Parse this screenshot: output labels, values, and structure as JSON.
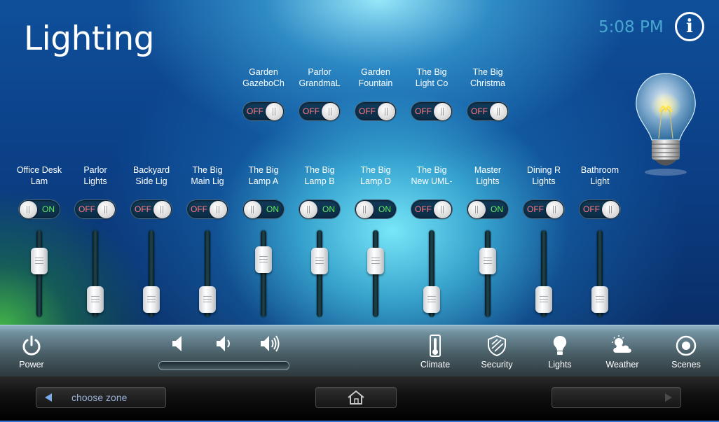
{
  "header": {
    "title": "Lighting",
    "time": "5:08 PM",
    "info_icon": "info-icon",
    "bulb_icon": "light-bulb-icon"
  },
  "top_row": [
    {
      "label": "Garden\nGazeboCh",
      "state": "OFF"
    },
    {
      "label": "Parlor\nGrandmaL",
      "state": "OFF"
    },
    {
      "label": "Garden\nFountain",
      "state": "OFF"
    },
    {
      "label": "The Big\nLight Co",
      "state": "OFF"
    },
    {
      "label": "The Big\nChristma",
      "state": "OFF"
    }
  ],
  "lights": [
    {
      "label": "Office   Desk\nLam",
      "state": "ON",
      "level": 0.72
    },
    {
      "label": "Parlor\nLights",
      "state": "OFF",
      "level": 0.15
    },
    {
      "label": "Backyard\nSide Lig",
      "state": "OFF",
      "level": 0.15
    },
    {
      "label": "The Big\nMain Lig",
      "state": "OFF",
      "level": 0.15
    },
    {
      "label": "The Big\nLamp A",
      "state": "ON",
      "level": 0.74
    },
    {
      "label": "The Big\nLamp B",
      "state": "ON",
      "level": 0.72
    },
    {
      "label": "The Big\nLamp D",
      "state": "ON",
      "level": 0.72
    },
    {
      "label": "The Big\nNew UML-",
      "state": "OFF",
      "level": 0.15
    },
    {
      "label": "Master\nLights",
      "state": "ON",
      "level": 0.72
    },
    {
      "label": "Dining R\nLights",
      "state": "OFF",
      "level": 0.15
    },
    {
      "label": "Bathroom\nLight",
      "state": "OFF",
      "level": 0.15
    }
  ],
  "bottom_bar": {
    "power_label": "Power",
    "nav": [
      {
        "label": "Climate",
        "icon": "thermometer-icon"
      },
      {
        "label": "Security",
        "icon": "shield-icon"
      },
      {
        "label": "Lights",
        "icon": "light-bulb-icon"
      },
      {
        "label": "Weather",
        "icon": "weather-icon"
      },
      {
        "label": "Scenes",
        "icon": "scenes-icon"
      }
    ],
    "volume_icons": [
      "volume-mute-icon",
      "volume-low-icon",
      "volume-high-icon"
    ]
  },
  "footer": {
    "zone_label": "choose zone",
    "home_icon": "home-icon"
  },
  "colors": {
    "on": "#5cf05a",
    "off": "#ff7b85",
    "clock": "#49a8cf"
  }
}
